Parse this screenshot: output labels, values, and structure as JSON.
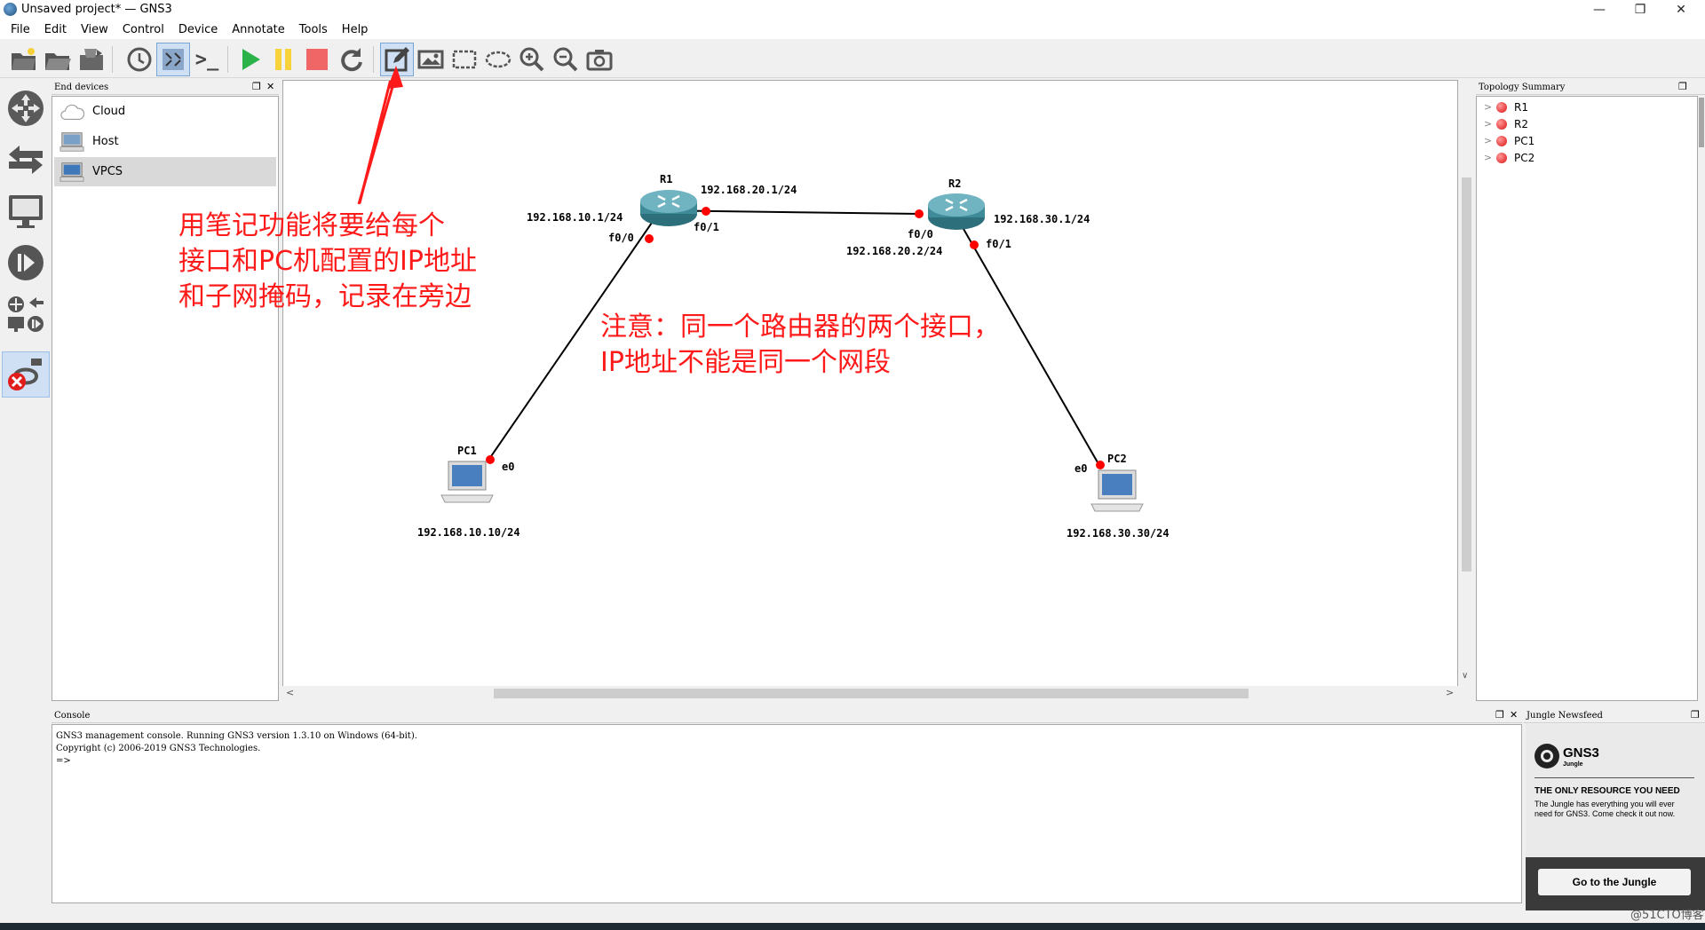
{
  "window": {
    "title": "Unsaved project* — GNS3",
    "controls": [
      "minimize",
      "restore",
      "close"
    ]
  },
  "menu": [
    "File",
    "Edit",
    "View",
    "Control",
    "Device",
    "Annotate",
    "Tools",
    "Help"
  ],
  "toolbar": [
    {
      "icon": "new-project-icon"
    },
    {
      "icon": "open-project-icon"
    },
    {
      "icon": "save-project-icon"
    },
    {
      "icon": "snapshot-clock-icon"
    },
    {
      "icon": "show-interface-labels-icon",
      "active": true
    },
    {
      "icon": "console-icon",
      "label": ">_"
    },
    {
      "icon": "start-all-icon"
    },
    {
      "icon": "suspend-all-icon"
    },
    {
      "icon": "stop-all-icon"
    },
    {
      "icon": "reload-all-icon"
    },
    {
      "icon": "add-note-icon",
      "active": true
    },
    {
      "icon": "insert-image-icon"
    },
    {
      "icon": "draw-rectangle-icon"
    },
    {
      "icon": "draw-ellipse-icon"
    },
    {
      "icon": "zoom-in-icon"
    },
    {
      "icon": "zoom-out-icon"
    },
    {
      "icon": "screenshot-icon"
    }
  ],
  "device_types": [
    "routers-icon",
    "switches-icon",
    "end-devices-icon",
    "security-devices-icon",
    "all-devices-icon",
    "add-link-icon"
  ],
  "end_devices": {
    "title": "End devices",
    "items": [
      {
        "label": "Cloud",
        "icon": "cloud-icon"
      },
      {
        "label": "Host",
        "icon": "host-icon"
      },
      {
        "label": "VPCS",
        "icon": "vpcs-icon",
        "selected": true
      }
    ]
  },
  "topology_summary": {
    "title": "Topology Summary",
    "nodes": [
      "R1",
      "R2",
      "PC1",
      "PC2"
    ],
    "status_color": "#dd1111"
  },
  "topology": {
    "nodes": {
      "r1": "R1",
      "r2": "R2",
      "pc1": "PC1",
      "pc2": "PC2"
    },
    "labels": {
      "r1_f00_ip": "192.168.10.1/24",
      "r1_f01_ip": "192.168.20.1/24",
      "r2_f00_ip": "192.168.20.2/24",
      "r2_f01_ip": "192.168.30.1/24",
      "pc1_ip": "192.168.10.10/24",
      "pc2_ip": "192.168.30.30/24",
      "r1_f00": "f0/0",
      "r1_f01": "f0/1",
      "r2_f00": "f0/0",
      "r2_f01": "f0/1",
      "pc1_e0": "e0",
      "pc2_e0": "e0"
    },
    "link_dot_color": "#ff0000"
  },
  "annotations": {
    "note1": [
      "用笔记功能将要给每个",
      "接口和PC机配置的IP地址",
      "和子网掩码，记录在旁边"
    ],
    "note2": [
      "注意：同一个路由器的两个接口，",
      "IP地址不能是同一个网段"
    ],
    "color": "#ff1a1a"
  },
  "console": {
    "title": "Console",
    "lines": [
      "GNS3 management console. Running GNS3 version 1.3.10 on Windows (64-bit).",
      "Copyright (c) 2006-2019 GNS3 Technologies.",
      "",
      "=>"
    ]
  },
  "jungle": {
    "title": "Jungle Newsfeed",
    "logo_text": "GNS3",
    "logo_sub": "Jungle",
    "headline": "THE ONLY RESOURCE YOU NEED",
    "body": "The Jungle has everything you will ever need for GNS3. Come check it out now.",
    "button": "Go to the Jungle"
  },
  "watermark": "@51CTO博客"
}
